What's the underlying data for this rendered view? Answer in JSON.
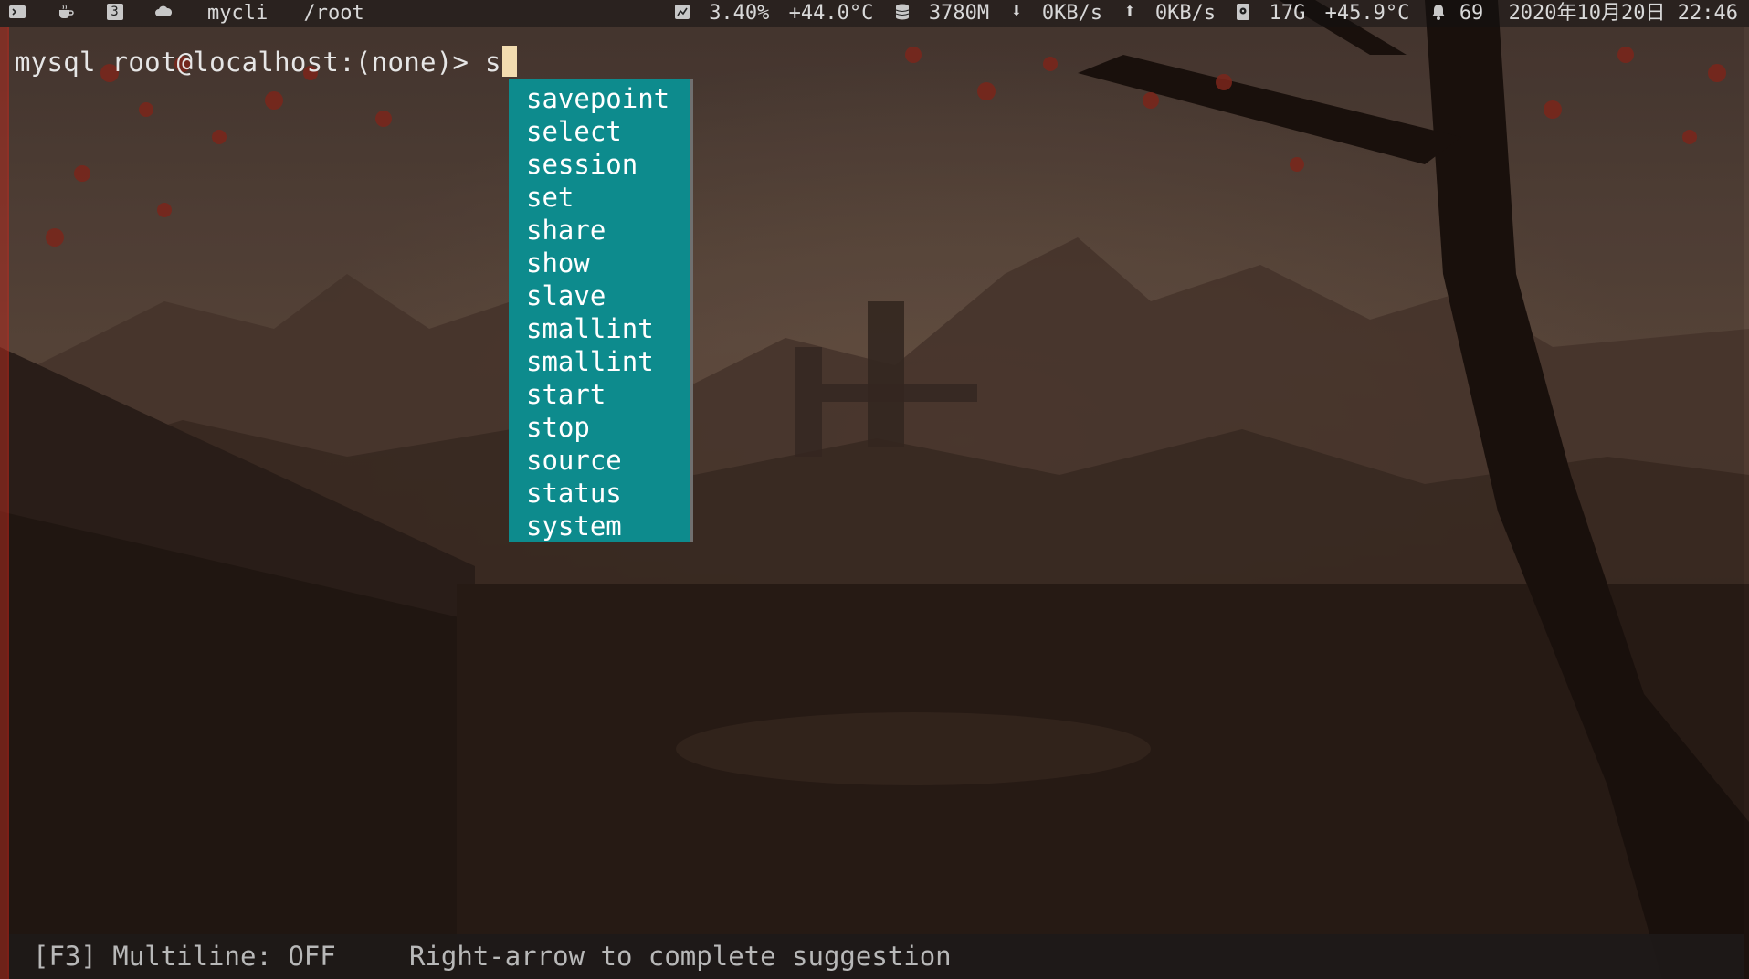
{
  "colors": {
    "menu_bg": "#0d8b8d",
    "menu_text": "#ffffff",
    "cursor": "#f2dcb0",
    "prompt_text": "#e6e6e6",
    "toolbar_text": "#b8b8b8"
  },
  "statusbar": {
    "workspace_icons": [
      "terminal-icon",
      "coffee-icon",
      "workspace-3-icon",
      "cloud-icon"
    ],
    "workspace_number": "3",
    "window_title": "mycli",
    "path": "/root",
    "cpu": "3.40%",
    "cpu_temp": "+44.0°C",
    "memory": "3780M",
    "net_down": "0KB/s",
    "net_up": "0KB/s",
    "disk": "17G",
    "disk_temp": "+45.9°C",
    "notifications": "69",
    "datetime": "2020年10月20日 22:46"
  },
  "terminal": {
    "prompt": "mysql root@localhost:(none)> ",
    "input": "s",
    "completions": [
      "savepoint",
      "select",
      "session",
      "set",
      "share",
      "show",
      "slave",
      "smallint",
      "smallint",
      "start",
      "stop",
      "source",
      "status",
      "system"
    ],
    "toolbar": {
      "multiline": "[F3] Multiline: OFF",
      "hint": "Right-arrow to complete suggestion"
    }
  }
}
